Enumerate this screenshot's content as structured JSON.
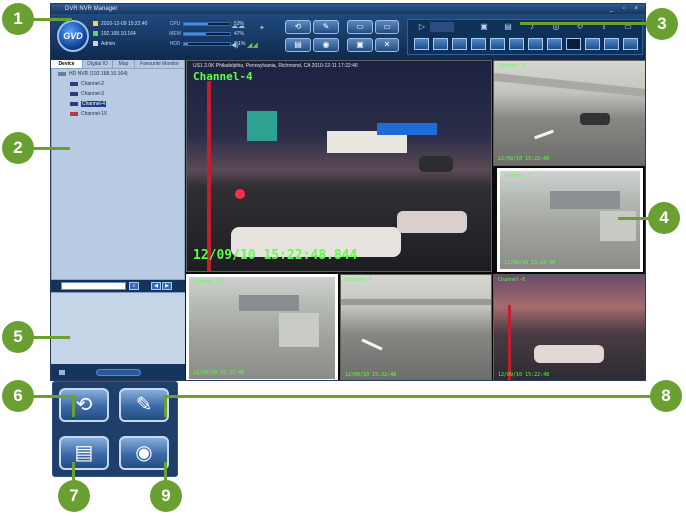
{
  "app": {
    "title": "DVR NVR Manager",
    "window_controls": "_ ▫ ×",
    "logo_text": "GVD"
  },
  "status": {
    "datetime": "2010-12-09  15:22:40",
    "ip": "192.168.10.164",
    "user": "Admin"
  },
  "meters": [
    {
      "label": "CPU",
      "percent": 53,
      "text": "53%"
    },
    {
      "label": "MEM",
      "percent": 47,
      "text": "47%"
    },
    {
      "label": "HDD",
      "percent": 8,
      "text": "8.1%"
    }
  ],
  "sidebar": {
    "tabs": [
      "Device",
      "Digital IO",
      "Map",
      "Favourite Monitor"
    ],
    "root_label": "HD NVR (192.168.10.164)",
    "channels": [
      {
        "label": "Channel-2",
        "selected": false,
        "online": true
      },
      {
        "label": "Channel-3",
        "selected": false,
        "online": true
      },
      {
        "label": "Channel-4",
        "selected": true,
        "online": true
      },
      {
        "label": "Channel-15",
        "selected": false,
        "online": false
      }
    ]
  },
  "videos": {
    "main": {
      "location": "US1 2.0K Philadelphia, Pennsylvania, Richmond, CA 2010-12-11 17:22:46",
      "channel": "Channel-4",
      "timestamp": "12/09/10 15:22:48.844"
    },
    "tiles": [
      {
        "channel": "Channel-2",
        "timestamp": "12/09/10 15:22:48"
      },
      {
        "channel": "Channel-3",
        "timestamp": "12/09/10 15:22:48"
      },
      {
        "channel": "Channel-15",
        "timestamp": "12/09/10 15:22:48"
      },
      {
        "channel": "Channel-5",
        "timestamp": "12/09/10 15:22:48"
      },
      {
        "channel": "Channel-6",
        "timestamp": "12/09/10 15:22:48"
      }
    ]
  },
  "callouts": [
    "1",
    "2",
    "3",
    "4",
    "5",
    "6",
    "7",
    "8",
    "9"
  ]
}
